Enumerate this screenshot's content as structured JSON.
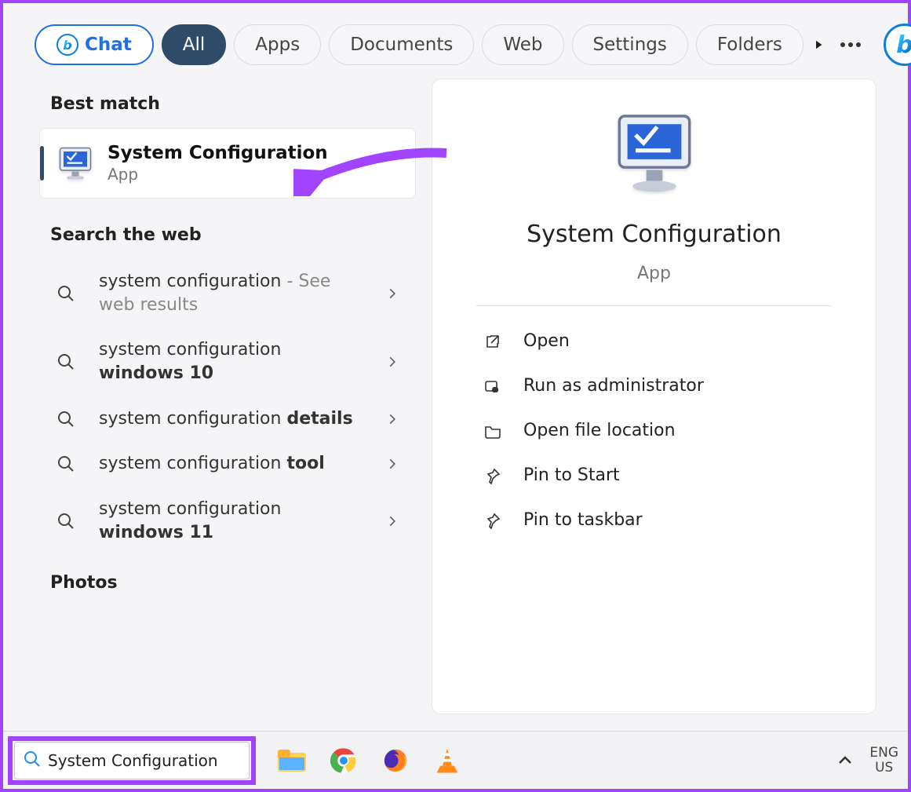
{
  "filters": {
    "chat": "Chat",
    "all": "All",
    "apps": "Apps",
    "documents": "Documents",
    "web": "Web",
    "settings": "Settings",
    "folders": "Folders"
  },
  "sections": {
    "best_match": "Best match",
    "search_web": "Search the web",
    "photos": "Photos"
  },
  "best_match": {
    "title": "System Configuration",
    "subtitle": "App"
  },
  "web_results": [
    {
      "prefix": "system configuration",
      "light": " - See web results",
      "bold": ""
    },
    {
      "prefix": "system configuration ",
      "light": "",
      "bold": "windows 10"
    },
    {
      "prefix": "system configuration ",
      "light": "",
      "bold": "details"
    },
    {
      "prefix": "system configuration ",
      "light": "",
      "bold": "tool"
    },
    {
      "prefix": "system configuration ",
      "light": "",
      "bold": "windows 11"
    }
  ],
  "panel": {
    "title": "System Configuration",
    "subtitle": "App",
    "actions": {
      "open": "Open",
      "run_admin": "Run as administrator",
      "open_loc": "Open file location",
      "pin_start": "Pin to Start",
      "pin_taskbar": "Pin to taskbar"
    }
  },
  "taskbar": {
    "search_value": "System Configuration",
    "lang_top": "ENG",
    "lang_bottom": "US"
  },
  "colors": {
    "accent_purple": "#a244ff",
    "pill_active": "#2f4b6a",
    "bing_blue": "#0a7fd9"
  }
}
